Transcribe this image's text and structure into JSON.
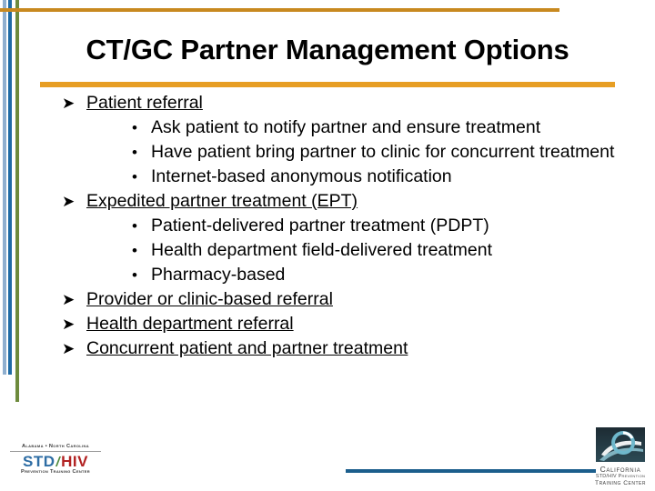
{
  "slide": {
    "title": "CT/GC Partner Management Options",
    "bullet_glyph": "➤",
    "sub_bullet_glyph": "•",
    "colors": {
      "top_rule": "#C8891F",
      "title_rule": "#E79E24",
      "footer_rule": "#1B5E8C",
      "bar_light_blue": "#8FAFCF",
      "bar_dark_blue": "#1F6BA5",
      "bar_green": "#6E8B3D",
      "text": "#000000",
      "background": "#FFFFFF"
    },
    "items": [
      {
        "label": "Patient referral",
        "underlined": true,
        "children": [
          "Ask patient to notify partner and ensure treatment",
          "Have patient bring partner to clinic for concurrent treatment",
          "Internet-based anonymous notification"
        ]
      },
      {
        "label": "Expedited partner treatment (EPT)",
        "underlined": true,
        "children": [
          "Patient-delivered partner treatment (PDPT)",
          "Health department field-delivered treatment",
          "Pharmacy-based"
        ]
      },
      {
        "label": "Provider or clinic-based referral",
        "underlined": true,
        "children": []
      },
      {
        "label": "Health department referral",
        "underlined": true,
        "children": []
      },
      {
        "label": "Concurrent patient and partner treatment",
        "underlined": true,
        "children": []
      }
    ]
  },
  "footer": {
    "logo_left": {
      "states": "Alabama • North Carolina",
      "mark_std": "STD",
      "mark_slash": "/",
      "mark_hiv": "HIV",
      "tagline": "Prevention Training Center"
    },
    "logo_right": {
      "name": "California",
      "sub1": "STD/HIV Prevention",
      "sub2": "Training Center"
    }
  }
}
